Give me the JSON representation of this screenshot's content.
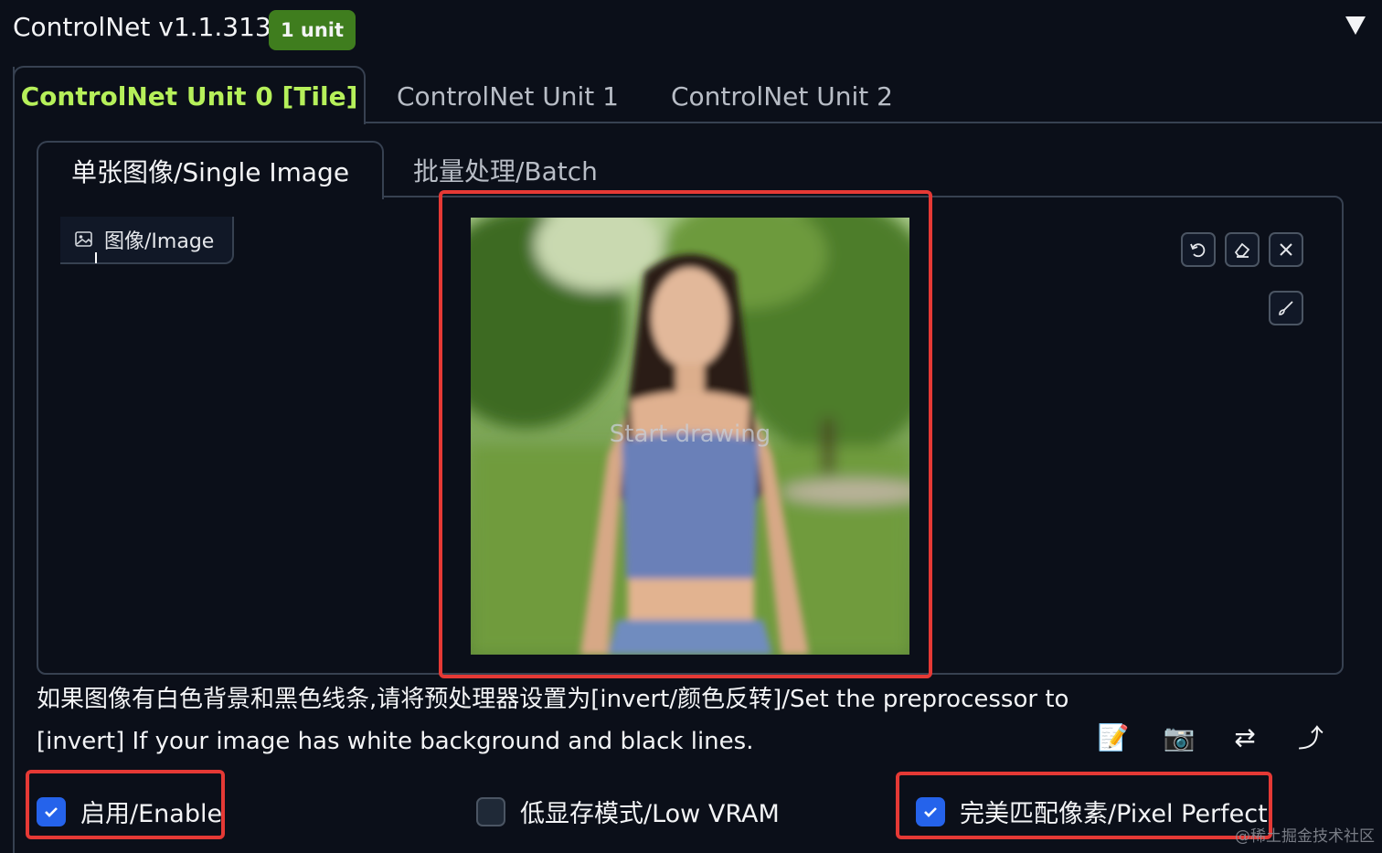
{
  "header": {
    "title": "ControlNet v1.1.313",
    "badge": "1 unit"
  },
  "tabs": [
    {
      "label": "ControlNet Unit 0 [Tile]",
      "active": true
    },
    {
      "label": "ControlNet Unit 1",
      "active": false
    },
    {
      "label": "ControlNet Unit 2",
      "active": false
    }
  ],
  "subtabs": [
    {
      "label": "单张图像/Single Image",
      "active": true
    },
    {
      "label": "批量处理/Batch",
      "active": false
    }
  ],
  "image_panel": {
    "label": "图像/Image",
    "canvas_hint": "Start drawing"
  },
  "tools": {
    "undo_icon": "undo-icon",
    "erase_icon": "eraser-icon",
    "clear_icon": "close-icon",
    "brush_icon": "brush-icon"
  },
  "info_text": "如果图像有白色背景和黑色线条,请将预处理器设置为[invert/颜色反转]/Set the preprocessor to [invert] If your image has white background and black lines.",
  "actions": [
    {
      "icon": "memo-icon",
      "glyph": "📝"
    },
    {
      "icon": "camera-icon",
      "glyph": "📷"
    },
    {
      "icon": "swap-icon",
      "glyph": "⇄"
    },
    {
      "icon": "send-up-icon",
      "glyph": "⤴"
    }
  ],
  "checkboxes": [
    {
      "label": "启用/Enable",
      "checked": true
    },
    {
      "label": "低显存模式/Low VRAM",
      "checked": false
    },
    {
      "label": "完美匹配像素/Pixel Perfect",
      "checked": true
    }
  ],
  "watermark": "@稀土掘金技术社区",
  "colors": {
    "background": "#0b0f19",
    "accent_tab": "#b6f05a",
    "badge": "#3f7d1e",
    "highlight": "#e53935",
    "checkbox": "#2563eb"
  }
}
